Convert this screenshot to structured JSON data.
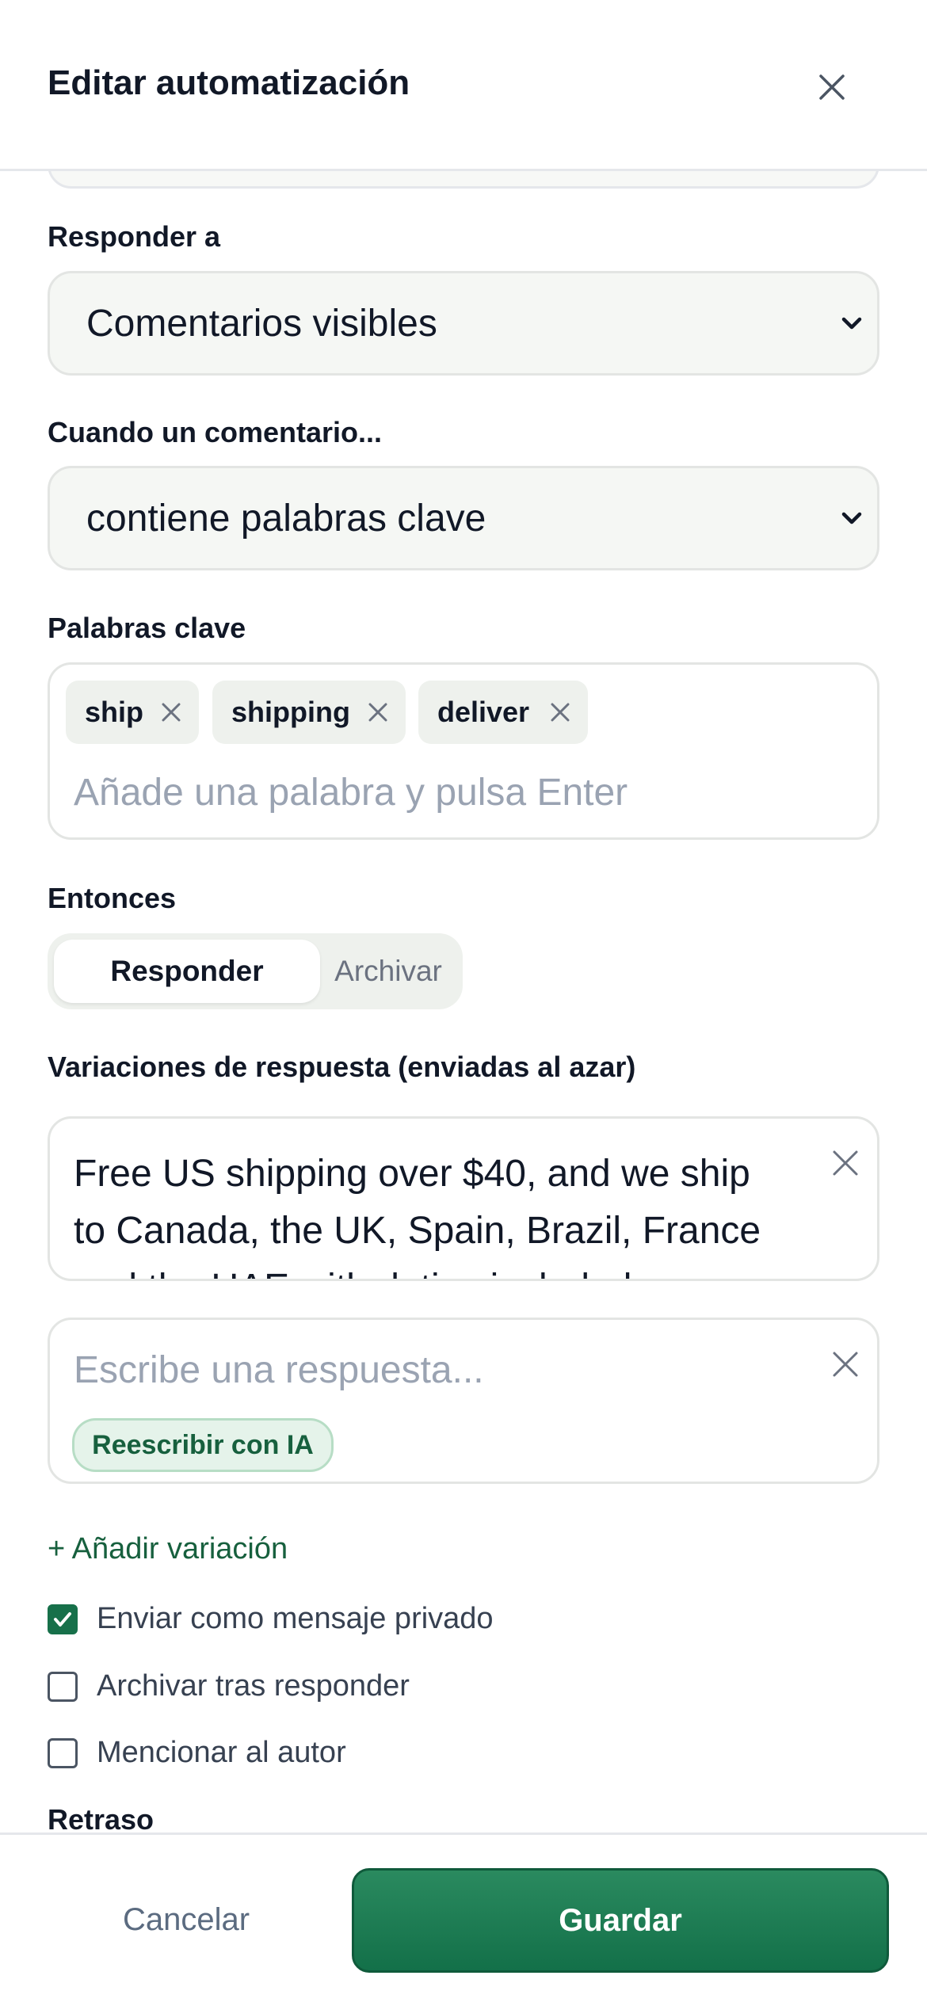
{
  "header": {
    "title": "Editar automatización",
    "close_icon": "close-icon"
  },
  "respond_to": {
    "label": "Responder a",
    "value": "Comentarios visibles"
  },
  "trigger": {
    "label": "Cuando un comentario...",
    "value": "contiene palabras clave"
  },
  "keywords": {
    "label": "Palabras clave",
    "chips": [
      "ship",
      "shipping",
      "deliver"
    ],
    "placeholder": "Añade una palabra y pulsa Enter"
  },
  "action": {
    "label": "Entonces",
    "options": [
      "Responder",
      "Archivar"
    ],
    "selected": "Responder"
  },
  "variations": {
    "label": "Variaciones de respuesta (enviadas al azar)",
    "items": [
      {
        "text": "Free US shipping over $40, and we ship to Canada, the UK, Spain, Brazil, France and the UAE with duties included"
      },
      {
        "text": "",
        "placeholder": "Escribe una respuesta...",
        "ai_button": "Reescribir con IA"
      }
    ],
    "add_label": "+ Añadir variación"
  },
  "options": [
    {
      "label": "Enviar como mensaje privado",
      "checked": true
    },
    {
      "label": "Archivar tras responder",
      "checked": false
    },
    {
      "label": "Mencionar al autor",
      "checked": false
    }
  ],
  "delay": {
    "label": "Retraso"
  },
  "footer": {
    "cancel_label": "Cancelar",
    "save_label": "Guardar"
  },
  "colors": {
    "accent": "#17704a",
    "accent_text": "#17603e",
    "field_bg": "#f5f7f4",
    "chip_bg": "#eef1ed"
  }
}
